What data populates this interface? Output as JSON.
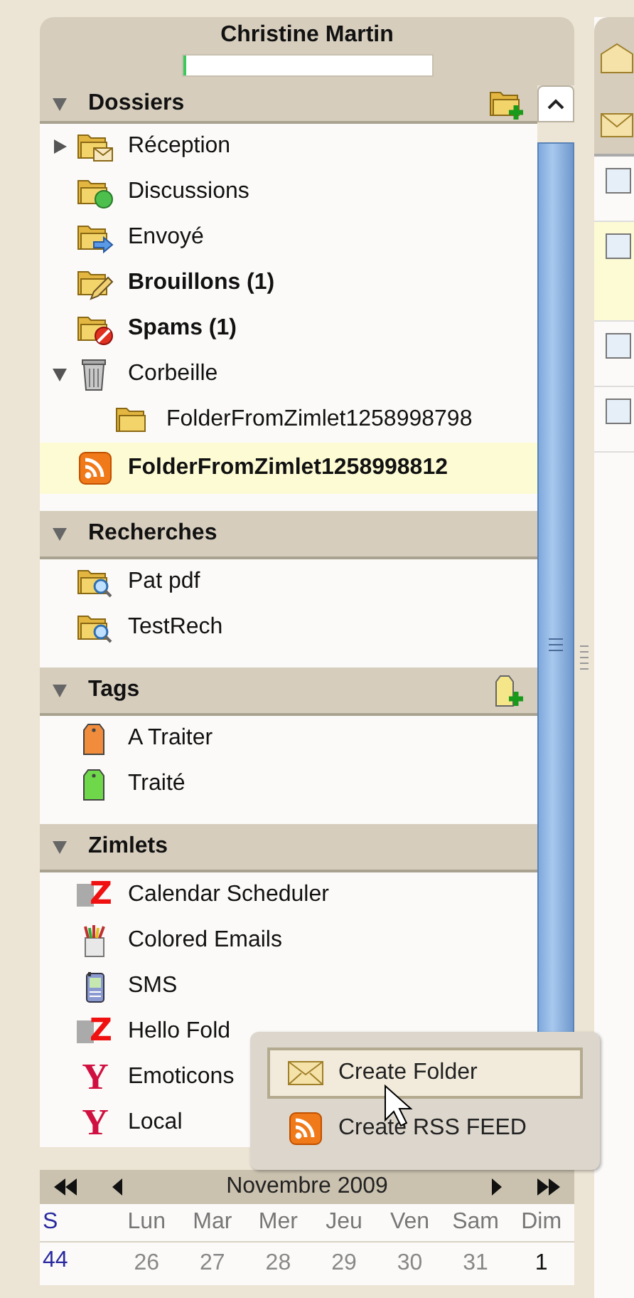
{
  "account": {
    "name": "Christine Martin",
    "quota": {
      "level": 0.01
    }
  },
  "sections": [
    {
      "title": "Dossiers",
      "expanded": true,
      "kind": "folders",
      "items": [
        {
          "label": "Réception",
          "kind": "inbox",
          "unread": false,
          "selected": false,
          "expanded": false
        },
        {
          "label": "Discussions",
          "kind": "chat",
          "unread": false,
          "selected": false
        },
        {
          "label": "Envoyé",
          "kind": "sent",
          "unread": false,
          "selected": false
        },
        {
          "label": "Brouillons (1)",
          "kind": "drafts",
          "unread": true,
          "selected": false
        },
        {
          "label": "Spams (1)",
          "kind": "spam",
          "unread": true,
          "selected": false
        },
        {
          "label": "Corbeille",
          "kind": "trash",
          "unread": false,
          "selected": false,
          "expanded": true,
          "children": [
            {
              "label": "FolderFromZimlet1258998798",
              "kind": "folder",
              "unread": false,
              "selected": false
            }
          ]
        },
        {
          "label": "FolderFromZimlet1258998812",
          "kind": "rss",
          "unread": true,
          "selected": true
        }
      ]
    },
    {
      "title": "Recherches",
      "expanded": true,
      "kind": "searches",
      "items": [
        {
          "label": "Pat pdf",
          "kind": "search",
          "unread": false,
          "selected": false
        },
        {
          "label": "TestRech",
          "kind": "search",
          "unread": false,
          "selected": false
        }
      ]
    },
    {
      "title": "Tags",
      "expanded": true,
      "kind": "tags",
      "items": [
        {
          "label": "A Traiter",
          "kind": "tag",
          "color": "#f08c3c",
          "unread": false,
          "selected": false
        },
        {
          "label": "Traité",
          "kind": "tag",
          "color": "#6fd84a",
          "unread": false,
          "selected": false
        }
      ]
    },
    {
      "title": "Zimlets",
      "expanded": true,
      "kind": "zimlets",
      "items": [
        {
          "label": "Calendar Scheduler",
          "kind": "zimlet",
          "glyph": "Z",
          "unread": false,
          "selected": false
        },
        {
          "label": "Colored Emails",
          "kind": "paint",
          "unread": false,
          "selected": false
        },
        {
          "label": "SMS",
          "kind": "phone",
          "unread": false,
          "selected": false
        },
        {
          "label": "Hello Fold",
          "kind": "zimlet",
          "glyph": "Z",
          "unread": false,
          "selected": false
        },
        {
          "label": "Emoticons",
          "kind": "yahoo",
          "glyph": "Y",
          "unread": false,
          "selected": false
        },
        {
          "label": "Local",
          "kind": "yahoo",
          "glyph": "Y",
          "unread": false,
          "selected": false
        }
      ]
    }
  ],
  "calendar": {
    "month": "Novembre 2009",
    "week_header": "S",
    "day_names": [
      "Lun",
      "Mar",
      "Mer",
      "Jeu",
      "Ven",
      "Sam",
      "Dim"
    ],
    "weeks": [
      {
        "number": "44",
        "days": [
          {
            "day": "26",
            "other_month": true
          },
          {
            "day": "27",
            "other_month": true
          },
          {
            "day": "28",
            "other_month": true
          },
          {
            "day": "29",
            "other_month": true
          },
          {
            "day": "30",
            "other_month": true
          },
          {
            "day": "31",
            "other_month": true
          },
          {
            "day": "1",
            "other_month": false
          }
        ]
      }
    ]
  },
  "context_menu": {
    "items": [
      {
        "label": "Create Folder",
        "kind": "folder-mail",
        "selected": true
      },
      {
        "label": "Create RSS FEED",
        "kind": "rss",
        "selected": false
      }
    ]
  },
  "message_list": {
    "rows": [
      {
        "checked": false,
        "selected": false
      },
      {
        "checked": false,
        "selected": true
      },
      {
        "checked": false,
        "selected": false
      },
      {
        "checked": false,
        "selected": false
      }
    ]
  }
}
